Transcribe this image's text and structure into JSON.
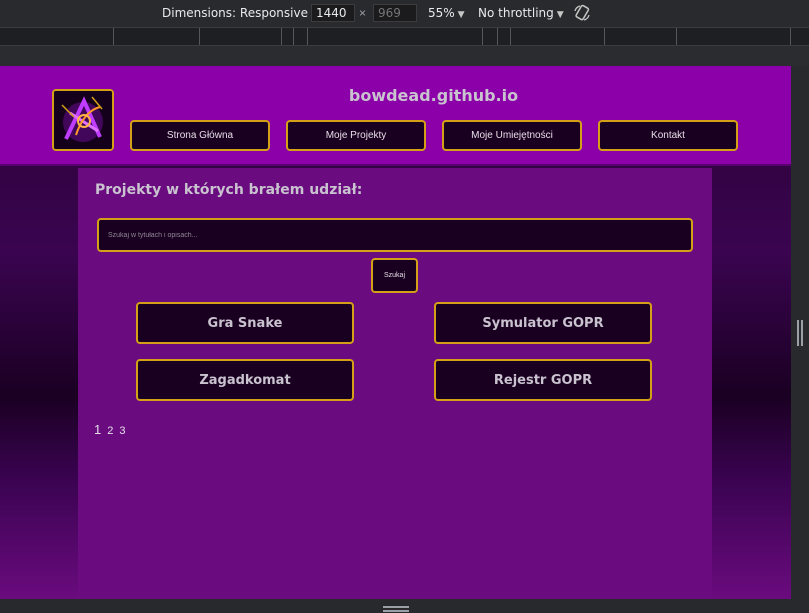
{
  "devtools": {
    "dimensions_label": "Dimensions: Responsive",
    "width_value": "1440",
    "height_placeholder": "969",
    "times": "×",
    "zoom": "55%",
    "throttling": "No throttling",
    "icons": [
      "caret-down-icon",
      "rotate-icon",
      "resize-grip-icon"
    ]
  },
  "site": {
    "title": "bowdead.github.io",
    "nav": [
      "Strona Główna",
      "Moje Projekty",
      "Moje Umiejętności",
      "Kontakt"
    ],
    "colors": {
      "header": "#8b00a8",
      "panel": "#6a0b80",
      "border": "#d4a017",
      "button_bg": "#1a0020"
    }
  },
  "main": {
    "section_title": "Projekty w których brałem udział:",
    "search_placeholder": "Szukaj w tytułach i opisach...",
    "search_button": "Szukaj",
    "projects": [
      "Gra Snake",
      "Symulator GOPR",
      "Zagadkomat",
      "Rejestr GOPR"
    ],
    "pages": [
      "1",
      "2",
      "3"
    ],
    "current_page": "1"
  }
}
